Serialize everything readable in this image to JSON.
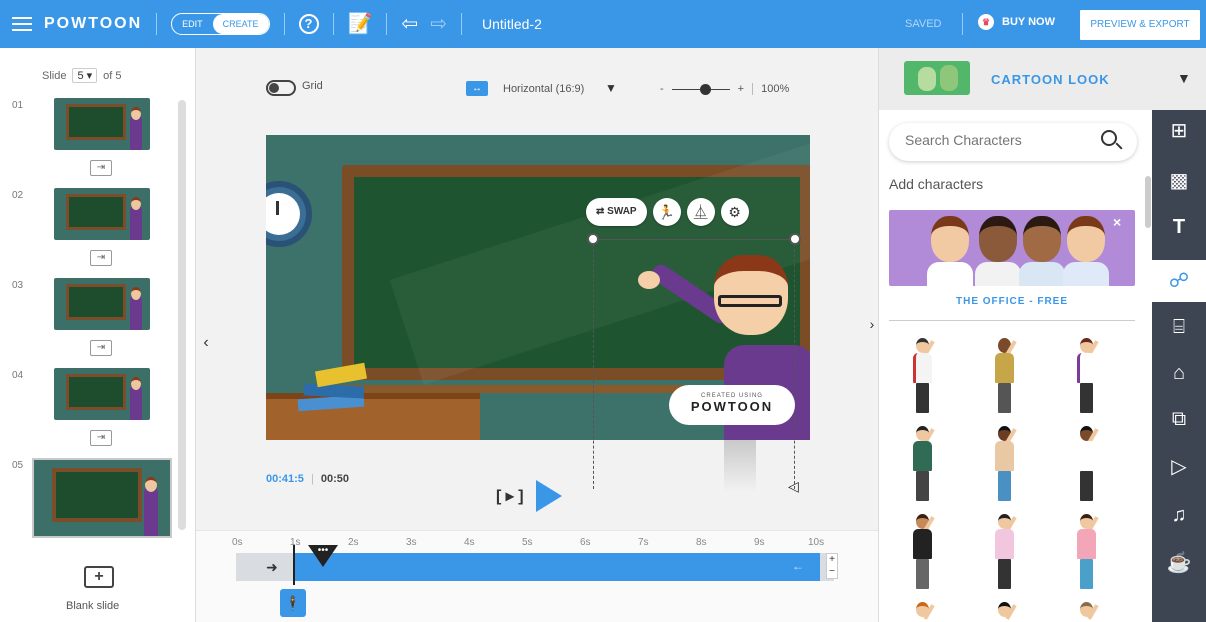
{
  "topbar": {
    "logo": "POWTOON",
    "mode_edit": "EDIT",
    "mode_create": "CREATE",
    "help": "?",
    "title": "Untitled-2",
    "saved": "SAVED",
    "buy_now": "BUY NOW",
    "preview_export": "PREVIEW & EXPORT",
    "accent": "#3a97e8"
  },
  "slides": {
    "label": "Slide",
    "current": "5",
    "of": "of 5",
    "items": [
      {
        "num": "01"
      },
      {
        "num": "02"
      },
      {
        "num": "03"
      },
      {
        "num": "04"
      },
      {
        "num": "05"
      }
    ],
    "transition_icon": "⇥",
    "add_icon": "+",
    "blank_slide": "Blank slide"
  },
  "canvas": {
    "grid_label": "Grid",
    "orientation_icon": "↔",
    "orientation": "Horizontal (16:9)",
    "zoom_minus": "-",
    "zoom_plus": "+",
    "zoom_value": "100%",
    "zoom_level": 0.5,
    "swap": "⇄ SWAP",
    "walk_icon": "🏃",
    "flip_icon": "⏅",
    "settings_icon": "⚙",
    "watermark_small": "CREATED USING",
    "watermark_big": "POWTOON",
    "left_arrow": "‹",
    "right_arrow": "›",
    "speaker_icon": "◁"
  },
  "playback": {
    "current": "00:41:5",
    "separator": "|",
    "total": "00:50",
    "bracket_play": "[ ▸ ]"
  },
  "timeline": {
    "ticks": [
      "0s",
      "1s",
      "2s",
      "3s",
      "4s",
      "5s",
      "6s",
      "7s",
      "8s",
      "9s",
      "10s"
    ],
    "start_arrow": "➜",
    "end_arrow": "←",
    "marker": "•••",
    "zoom_plus": "+",
    "zoom_minus": "−",
    "char_chip": "🕴"
  },
  "library": {
    "style_name": "CARTOON LOOK",
    "style_caret": "▼",
    "search_placeholder": "Search Characters",
    "add_characters": "Add characters",
    "pack_name": "THE OFFICE - FREE",
    "close": "×"
  },
  "rail": {
    "items": [
      {
        "icon": "⊞",
        "name": "layout-icon"
      },
      {
        "icon": "▩",
        "name": "background-icon"
      },
      {
        "icon": "T",
        "name": "text-icon"
      },
      {
        "icon": "☍",
        "name": "characters-icon"
      },
      {
        "icon": "⌸",
        "name": "props-icon"
      },
      {
        "icon": "⌂",
        "name": "shapes-icon"
      },
      {
        "icon": "⧉",
        "name": "media-icon"
      },
      {
        "icon": "▷",
        "name": "video-icon"
      },
      {
        "icon": "♫",
        "name": "music-icon"
      },
      {
        "icon": "☕",
        "name": "specials-icon"
      }
    ]
  }
}
